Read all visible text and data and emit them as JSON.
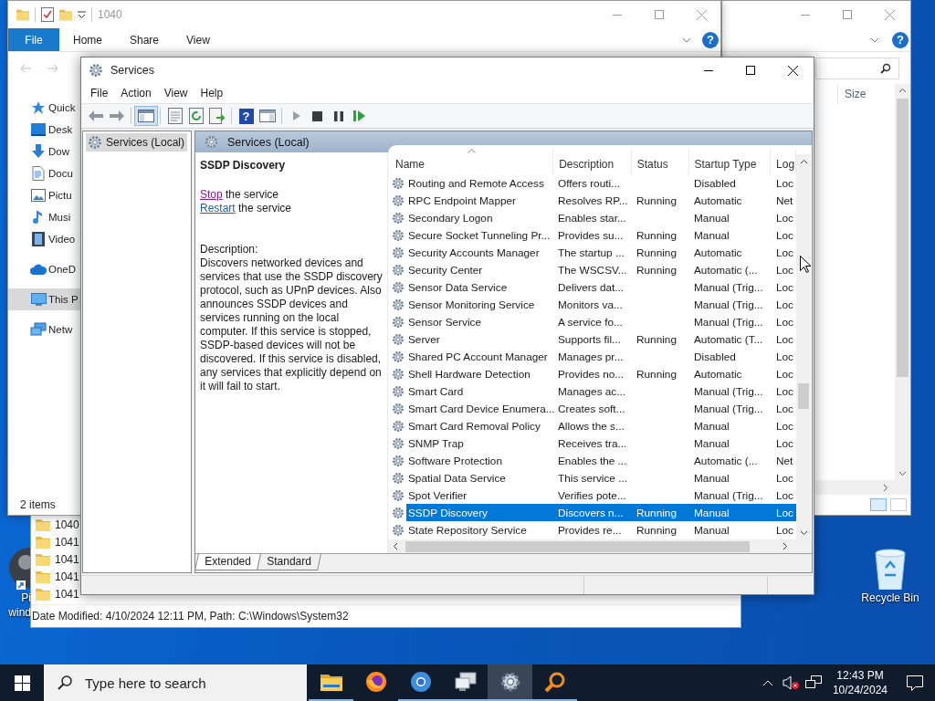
{
  "desktop": {
    "icons": [
      {
        "kind": "app",
        "lines": [
          "Pi",
          "wind"
        ]
      },
      {
        "kind": "recycle-bin",
        "lines": [
          "Recycle Bin"
        ]
      }
    ]
  },
  "explorer_right": {
    "help_glyph": "?",
    "columns": [
      "Size"
    ]
  },
  "explorer_bottom": {
    "folders": [
      "1040",
      "1041",
      "1041",
      "1041",
      "1041"
    ],
    "status": "Date Modified: 4/10/2024 12:11 PM, Path: C:\\Windows\\System32"
  },
  "explorer_back": {
    "title": "1040",
    "help_glyph": "?",
    "ribbon_tabs": [
      {
        "label": "File",
        "kind": "file"
      },
      {
        "label": "Home",
        "kind": "tab"
      },
      {
        "label": "Share",
        "kind": "tab"
      },
      {
        "label": "View",
        "kind": "tab"
      }
    ],
    "nav_groups": [
      [
        {
          "kind": "star",
          "label": "Quick",
          "selected": false
        },
        {
          "kind": "desktop",
          "label": "Desk",
          "selected": false
        },
        {
          "kind": "download",
          "label": "Dow",
          "selected": false
        },
        {
          "kind": "document",
          "label": "Docu",
          "selected": false
        },
        {
          "kind": "pictures",
          "label": "Pictu",
          "selected": false
        },
        {
          "kind": "music",
          "label": "Musi",
          "selected": false
        },
        {
          "kind": "video",
          "label": "Video",
          "selected": false
        }
      ],
      [
        {
          "kind": "cloud",
          "label": "OneD",
          "selected": false
        }
      ],
      [
        {
          "kind": "pc",
          "label": "This P",
          "selected": true
        }
      ],
      [
        {
          "kind": "network",
          "label": "Netw",
          "selected": false
        }
      ]
    ],
    "status": "2 items"
  },
  "services_window": {
    "title": "Services",
    "menu": [
      "File",
      "Action",
      "View",
      "Help"
    ],
    "help_glyph": "?",
    "tree": [
      {
        "label": "Services (Local)",
        "selected": true
      }
    ],
    "header": "Services (Local)",
    "detail": {
      "name": "SSDP Discovery",
      "actions": [
        {
          "link": "Stop",
          "rest": "the service",
          "visited": true
        },
        {
          "link": "Restart",
          "rest": "the service",
          "visited": false
        }
      ],
      "description_label": "Description:",
      "description": "Discovers networked devices and services that use the SSDP discovery protocol, such as UPnP devices. Also announces SSDP devices and services running on the local computer. If this service is stopped, SSDP-based devices will not be discovered. If this service is disabled, any services that explicitly depend on it will fail to start."
    },
    "table": {
      "columns": [
        {
          "label": "Name",
          "sorted": true
        },
        {
          "label": "Description",
          "sorted": false
        },
        {
          "label": "Status",
          "sorted": false
        },
        {
          "label": "Startup Type",
          "sorted": false
        },
        {
          "label": "Log",
          "sorted": false
        }
      ],
      "rows": [
        {
          "cells": [
            "Routing and Remote Access",
            "Offers routi...",
            "",
            "Disabled",
            "Loc"
          ],
          "selected": false
        },
        {
          "cells": [
            "RPC Endpoint Mapper",
            "Resolves RP...",
            "Running",
            "Automatic",
            "Net"
          ],
          "selected": false
        },
        {
          "cells": [
            "Secondary Logon",
            "Enables star...",
            "",
            "Manual",
            "Loc"
          ],
          "selected": false
        },
        {
          "cells": [
            "Secure Socket Tunneling Pr...",
            "Provides su...",
            "Running",
            "Manual",
            "Loc"
          ],
          "selected": false
        },
        {
          "cells": [
            "Security Accounts Manager",
            "The startup ...",
            "Running",
            "Automatic",
            "Loc"
          ],
          "selected": false
        },
        {
          "cells": [
            "Security Center",
            "The WSCSV...",
            "Running",
            "Automatic (...",
            "Loc"
          ],
          "selected": false
        },
        {
          "cells": [
            "Sensor Data Service",
            "Delivers dat...",
            "",
            "Manual (Trig...",
            "Loc"
          ],
          "selected": false
        },
        {
          "cells": [
            "Sensor Monitoring Service",
            "Monitors va...",
            "",
            "Manual (Trig...",
            "Loc"
          ],
          "selected": false
        },
        {
          "cells": [
            "Sensor Service",
            "A service fo...",
            "",
            "Manual (Trig...",
            "Loc"
          ],
          "selected": false
        },
        {
          "cells": [
            "Server",
            "Supports fil...",
            "Running",
            "Automatic (T...",
            "Loc"
          ],
          "selected": false
        },
        {
          "cells": [
            "Shared PC Account Manager",
            "Manages pr...",
            "",
            "Disabled",
            "Loc"
          ],
          "selected": false
        },
        {
          "cells": [
            "Shell Hardware Detection",
            "Provides no...",
            "Running",
            "Automatic",
            "Loc"
          ],
          "selected": false
        },
        {
          "cells": [
            "Smart Card",
            "Manages ac...",
            "",
            "Manual (Trig...",
            "Loc"
          ],
          "selected": false
        },
        {
          "cells": [
            "Smart Card Device Enumera...",
            "Creates soft...",
            "",
            "Manual (Trig...",
            "Loc"
          ],
          "selected": false
        },
        {
          "cells": [
            "Smart Card Removal Policy",
            "Allows the s...",
            "",
            "Manual",
            "Loc"
          ],
          "selected": false
        },
        {
          "cells": [
            "SNMP Trap",
            "Receives tra...",
            "",
            "Manual",
            "Loc"
          ],
          "selected": false
        },
        {
          "cells": [
            "Software Protection",
            "Enables the ...",
            "",
            "Automatic (...",
            "Net"
          ],
          "selected": false
        },
        {
          "cells": [
            "Spatial Data Service",
            "This service ...",
            "",
            "Manual",
            "Loc"
          ],
          "selected": false
        },
        {
          "cells": [
            "Spot Verifier",
            "Verifies pote...",
            "",
            "Manual (Trig...",
            "Loc"
          ],
          "selected": false
        },
        {
          "cells": [
            "SSDP Discovery",
            "Discovers n...",
            "Running",
            "Manual",
            "Loc"
          ],
          "selected": true
        },
        {
          "cells": [
            "State Repository Service",
            "Provides re...",
            "Running",
            "Manual",
            "Loc"
          ],
          "selected": false
        }
      ]
    },
    "view_tabs": [
      {
        "label": "Extended",
        "selected": true
      },
      {
        "label": "Standard",
        "selected": false
      }
    ]
  },
  "taskbar": {
    "search_placeholder": "Type here to search",
    "apps": [
      {
        "kind": "folder",
        "open": true,
        "active": false
      },
      {
        "kind": "firefox",
        "open": false,
        "active": false
      },
      {
        "kind": "chrome",
        "open": true,
        "active": false
      },
      {
        "kind": "remote",
        "open": true,
        "active": false
      },
      {
        "kind": "gear",
        "open": true,
        "active": true
      },
      {
        "kind": "magnifier",
        "open": true,
        "active": false
      }
    ],
    "volume_muted": true,
    "time": "12:43 PM",
    "date": "10/24/2024"
  }
}
